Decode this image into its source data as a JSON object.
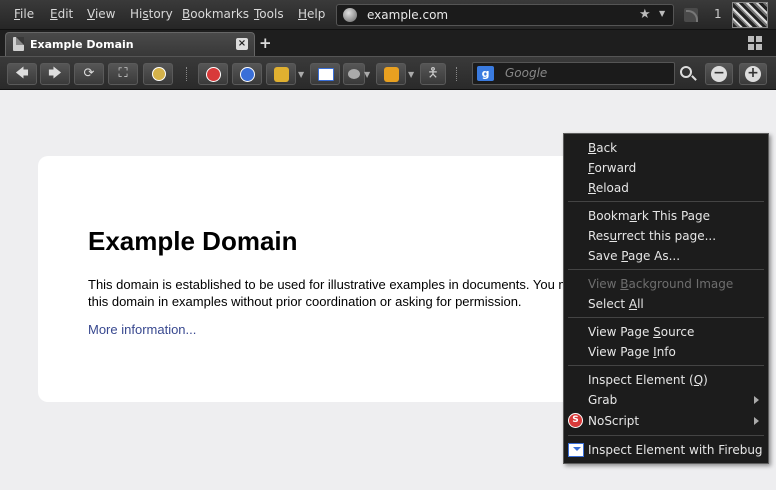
{
  "menubar": {
    "items": [
      {
        "key": "F",
        "rest": "ile"
      },
      {
        "key": "E",
        "rest": "dit"
      },
      {
        "key": "V",
        "rest": "iew"
      },
      {
        "pre": "Hi",
        "key": "s",
        "rest": "tory"
      },
      {
        "key": "B",
        "rest": "ookmarks"
      },
      {
        "key": "T",
        "rest": "ools"
      },
      {
        "key": "H",
        "rest": "elp"
      }
    ]
  },
  "urlbar": {
    "value": "example.com"
  },
  "counter": "1",
  "tab": {
    "title": "Example Domain",
    "close": "×",
    "new_tab": "+"
  },
  "search": {
    "placeholder": "Google",
    "engine_label": "g"
  },
  "page": {
    "heading": "Example Domain",
    "paragraph": "This domain is established to be used for illustrative examples in documents. You may use this domain in examples without prior coordination or asking for permission.",
    "link": "More information..."
  },
  "context_menu": {
    "items": [
      {
        "id": "back",
        "pre": "",
        "key": "B",
        "rest": "ack",
        "disabled": false
      },
      {
        "id": "forward",
        "pre": "",
        "key": "F",
        "rest": "orward",
        "disabled": false
      },
      {
        "id": "reload",
        "pre": "",
        "key": "R",
        "rest": "eload",
        "disabled": false
      },
      {
        "id": "bookmark",
        "pre": "Bookm",
        "key": "a",
        "rest": "rk This Page",
        "disabled": false
      },
      {
        "id": "resurrect",
        "pre": "Res",
        "key": "u",
        "rest": "rrect this page...",
        "disabled": false
      },
      {
        "id": "save-page",
        "pre": "Save ",
        "key": "P",
        "rest": "age As...",
        "disabled": false
      },
      {
        "id": "view-bg",
        "pre": "View ",
        "key": "B",
        "rest": "ackground Image",
        "disabled": true
      },
      {
        "id": "select-all",
        "pre": "Select ",
        "key": "A",
        "rest": "ll",
        "disabled": false
      },
      {
        "id": "view-source",
        "pre": "View Page ",
        "key": "S",
        "rest": "ource",
        "disabled": false
      },
      {
        "id": "page-info",
        "pre": "View Page ",
        "key": "I",
        "rest": "nfo",
        "disabled": false
      },
      {
        "id": "inspect",
        "pre": "Inspect Element (",
        "key": "Q",
        "rest": ")",
        "disabled": false
      },
      {
        "id": "grab",
        "pre": "Grab",
        "key": "",
        "rest": "",
        "disabled": false,
        "submenu": true
      },
      {
        "id": "noscript",
        "pre": "NoScript",
        "key": "",
        "rest": "",
        "disabled": false,
        "submenu": true
      },
      {
        "id": "firebug",
        "pre": "Inspect Element with Firebug",
        "key": "",
        "rest": "",
        "disabled": false
      }
    ]
  },
  "colors": {
    "chrome_dark": "#262626",
    "page_bg": "#eeeef0",
    "link": "#38488f",
    "menu_bg": "#1c1c1c"
  }
}
